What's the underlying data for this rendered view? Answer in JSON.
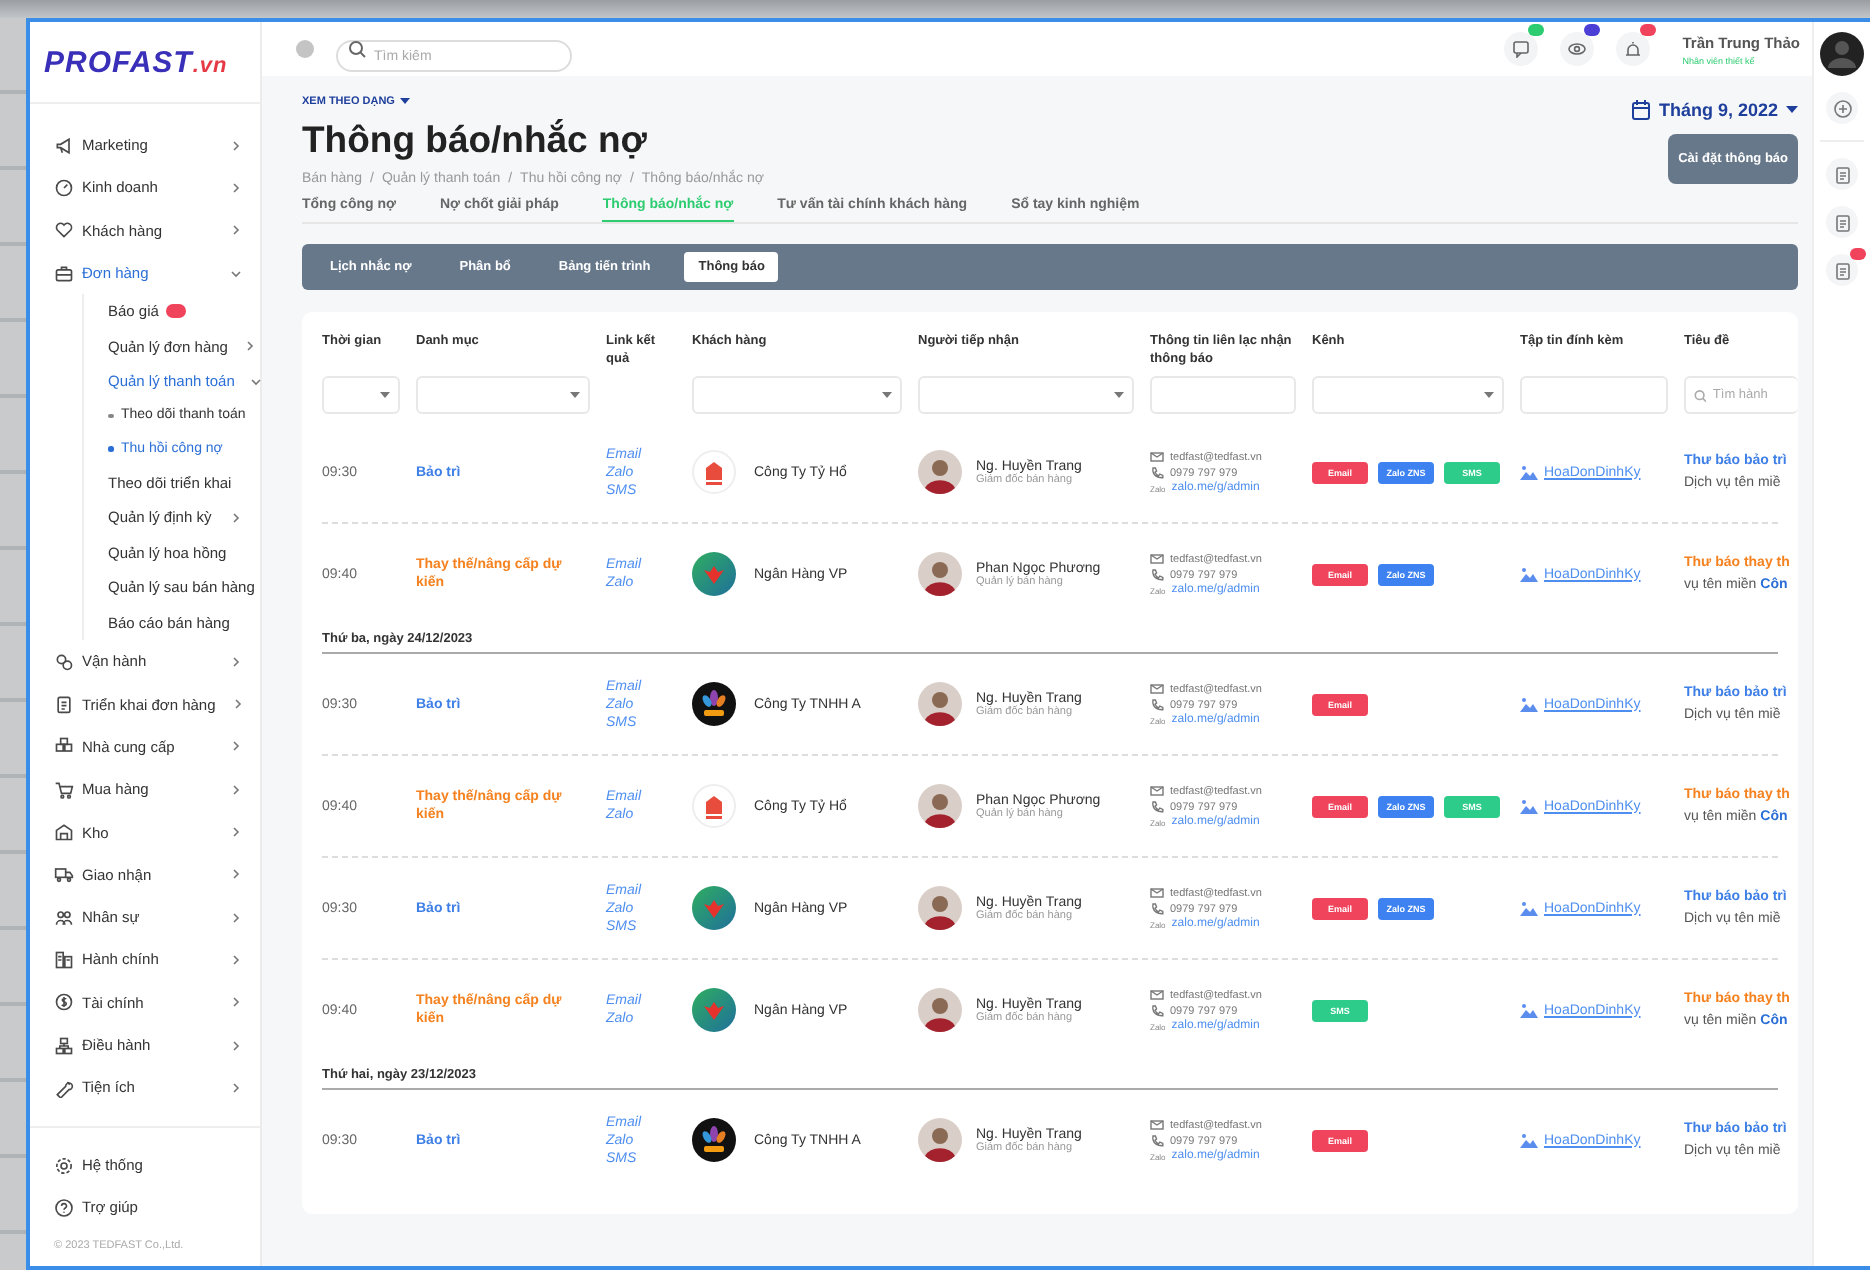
{
  "sidebar": {
    "logo": "PROFAST",
    "logo_suffix": ".vn",
    "nav": [
      {
        "label": "Marketing",
        "kind": "group",
        "expanded": false,
        "selected": false
      },
      {
        "label": "Kinh doanh",
        "kind": "group",
        "expanded": false,
        "selected": false
      },
      {
        "label": "Khách hàng",
        "kind": "group",
        "expanded": false,
        "selected": false
      },
      {
        "label": "Đơn hàng",
        "kind": "group",
        "expanded": true,
        "selected": true,
        "children": [
          {
            "label": "Báo giá",
            "kind": "link",
            "selected": false,
            "badge": true
          },
          {
            "label": "Quản lý đơn hàng",
            "kind": "group",
            "expanded": false,
            "selected": false
          },
          {
            "label": "Quản lý thanh toán",
            "kind": "group",
            "expanded": true,
            "selected": true,
            "children": [
              {
                "label": "Theo dõi thanh toán",
                "kind": "bullet",
                "selected": false
              },
              {
                "label": "Thu hồi công nợ",
                "kind": "bullet",
                "selected": true
              }
            ]
          },
          {
            "label": "Theo dõi triển khai",
            "kind": "link",
            "selected": false
          },
          {
            "label": "Quản lý định kỳ",
            "kind": "group",
            "expanded": false,
            "selected": false
          },
          {
            "label": "Quản lý hoa hồng",
            "kind": "link",
            "selected": false
          },
          {
            "label": "Quản lý sau bán hàng",
            "kind": "link",
            "selected": false
          },
          {
            "label": "Báo cáo bán hàng",
            "kind": "link",
            "selected": false
          }
        ]
      },
      {
        "label": "Vận hành",
        "kind": "group",
        "expanded": false,
        "selected": false
      },
      {
        "label": "Triển khai đơn hàng",
        "kind": "group",
        "expanded": false,
        "selected": false
      },
      {
        "label": "Nhà cung cấp",
        "kind": "group",
        "expanded": false,
        "selected": false
      },
      {
        "label": "Mua hàng",
        "kind": "group",
        "expanded": false,
        "selected": false
      },
      {
        "label": "Kho",
        "kind": "group",
        "expanded": false,
        "selected": false
      },
      {
        "label": "Giao nhận",
        "kind": "group",
        "expanded": false,
        "selected": false
      },
      {
        "label": "Nhân sự",
        "kind": "group",
        "expanded": false,
        "selected": false
      },
      {
        "label": "Hành chính",
        "kind": "group",
        "expanded": false,
        "selected": false
      },
      {
        "label": "Tài chính",
        "kind": "group",
        "expanded": false,
        "selected": false
      },
      {
        "label": "Điều hành",
        "kind": "group",
        "expanded": false,
        "selected": false
      },
      {
        "label": "Tiện ích",
        "kind": "group",
        "expanded": false,
        "selected": false
      }
    ],
    "footer_nav": [
      {
        "label": "Hệ thống"
      },
      {
        "label": "Trợ giúp"
      }
    ],
    "copyright": "© 2023 TEDFAST Co.,Ltd."
  },
  "topbar": {
    "search": {
      "placeholder": "Tìm kiếm"
    },
    "icons": [
      {
        "color": "#2ecc71"
      },
      {
        "color": "#4b3fd6"
      },
      {
        "color": "#f0435c"
      }
    ],
    "user": {
      "name": "Trần Trung Thảo",
      "role": "Nhân viên thiết kế"
    }
  },
  "rail": [
    {
      "badge": false
    },
    {
      "badge": false
    },
    {
      "badge": false
    },
    {
      "badge": true
    }
  ],
  "page": {
    "view_switch": {
      "label": "XEM THEO DẠNG",
      "expanded": false
    },
    "title": "Thông báo/nhắc nợ",
    "breadcrumb": [
      {
        "label": "Bán hàng"
      },
      {
        "separator": "/",
        "label": "Quản lý thanh toán"
      },
      {
        "separator": "/",
        "label": "Thu hồi công nợ"
      },
      {
        "separator": "/",
        "label": "Thông báo/nhắc nợ"
      }
    ],
    "month": "Tháng 9, 2022",
    "settings_button": "Cài đặt thông báo"
  },
  "tabs": [
    {
      "label": "Tổng công nợ",
      "selected": false
    },
    {
      "label": "Nợ chốt giải pháp",
      "selected": false
    },
    {
      "label": "Thông báo/nhắc nợ",
      "selected": true
    },
    {
      "label": "Tư vấn tài chính khách hàng",
      "selected": false
    },
    {
      "label": "Sổ tay kinh nghiệm",
      "selected": false
    }
  ],
  "subtabs": [
    {
      "label": "Lịch nhắc nợ",
      "selected": false
    },
    {
      "label": "Phân bổ",
      "selected": false
    },
    {
      "label": "Bảng tiến trình",
      "selected": false
    },
    {
      "label": "Thông báo",
      "selected": true
    }
  ],
  "table": {
    "columns": [
      {
        "label": "Thời gian",
        "filter": {
          "kind": "select"
        }
      },
      {
        "label": "Danh mục",
        "filter": {
          "kind": "select"
        }
      },
      {
        "label": "Link kết quả"
      },
      {
        "label": "Khách hàng",
        "filter": {
          "kind": "select"
        }
      },
      {
        "label": "Người tiếp nhận",
        "filter": {
          "kind": "select"
        }
      },
      {
        "label": "Thông tin liên lạc nhận thông báo",
        "filter": {
          "kind": "input"
        }
      },
      {
        "label": "Kênh",
        "filter": {
          "kind": "select"
        }
      },
      {
        "label": "Tập tin đính kèm",
        "filter": {
          "kind": "input"
        }
      },
      {
        "label": "Tiêu đề",
        "filter": {
          "kind": "search",
          "placeholder": "Tìm hành"
        }
      }
    ],
    "groups": [
      {
        "rows": [
          {
            "time": "09:30",
            "kind": "maintenance",
            "category": "Bảo trì",
            "links": [
              "Email",
              "Zalo",
              "SMS"
            ],
            "customer": {
              "name": "Công Ty Tỷ Hổ",
              "kind": "tyho"
            },
            "recipient": {
              "name": "Ng. Huyền Trang",
              "role": "Giám đốc bán hàng"
            },
            "contact": {
              "email": "tedfast@tedfast.vn",
              "phone": "0979 797 979",
              "zalo_label": "Zalo",
              "zalo": "zalo.me/g/admin"
            },
            "channels": [
              {
                "label": "Email",
                "color": "#f0435c"
              },
              {
                "label": "Zalo ZNS",
                "color": "#3d82f0"
              },
              {
                "label": "SMS",
                "color": "#2ecc8a"
              }
            ],
            "file": "HoaDonDinhKy",
            "title": "Thư báo bảo trì",
            "subtitle": "Dịch vụ tên miề"
          },
          {
            "time": "09:40",
            "kind": "replace",
            "category": "Thay thế/nâng cấp dự kiến",
            "links": [
              "Email",
              "Zalo"
            ],
            "customer": {
              "name": "Ngân Hàng VP",
              "kind": "bank"
            },
            "recipient": {
              "name": "Phan Ngọc Phương",
              "role": "Quản lý bán hàng"
            },
            "contact": {
              "email": "tedfast@tedfast.vn",
              "phone": "0979 797 979",
              "zalo_label": "Zalo",
              "zalo": "zalo.me/g/admin"
            },
            "channels": [
              {
                "label": "Email",
                "color": "#f0435c"
              },
              {
                "label": "Zalo ZNS",
                "color": "#3d82f0"
              }
            ],
            "file": "HoaDonDinhKy",
            "title": "Thư báo thay th",
            "subtitle": "vụ tên miền **Côn**"
          }
        ]
      },
      {
        "date": "Thứ ba, ngày 24/12/2023",
        "rows": [
          {
            "time": "09:30",
            "kind": "maintenance",
            "category": "Bảo trì",
            "links": [
              "Email",
              "Zalo",
              "SMS"
            ],
            "customer": {
              "name": "Công Ty TNHH A",
              "kind": "lotus"
            },
            "recipient": {
              "name": "Ng. Huyền Trang",
              "role": "Giám đốc bán hàng"
            },
            "contact": {
              "email": "tedfast@tedfast.vn",
              "phone": "0979 797 979",
              "zalo_label": "Zalo",
              "zalo": "zalo.me/g/admin"
            },
            "channels": [
              {
                "label": "Email",
                "color": "#f0435c"
              }
            ],
            "file": "HoaDonDinhKy",
            "title": "Thư báo bảo trì",
            "subtitle": "Dịch vụ tên miề"
          },
          {
            "time": "09:40",
            "kind": "replace",
            "category": "Thay thế/nâng cấp dự kiến",
            "links": [
              "Email",
              "Zalo"
            ],
            "customer": {
              "name": "Công Ty Tỷ Hổ",
              "kind": "tyho"
            },
            "recipient": {
              "name": "Phan Ngọc Phương",
              "role": "Quản lý bán hàng"
            },
            "contact": {
              "email": "tedfast@tedfast.vn",
              "phone": "0979 797 979",
              "zalo_label": "Zalo",
              "zalo": "zalo.me/g/admin"
            },
            "channels": [
              {
                "label": "Email",
                "color": "#f0435c"
              },
              {
                "label": "Zalo ZNS",
                "color": "#3d82f0"
              },
              {
                "label": "SMS",
                "color": "#2ecc8a"
              }
            ],
            "file": "HoaDonDinhKy",
            "title": "Thư báo thay th",
            "subtitle": "vụ tên miền **Côn**"
          },
          {
            "time": "09:30",
            "kind": "maintenance",
            "category": "Bảo trì",
            "links": [
              "Email",
              "Zalo",
              "SMS"
            ],
            "customer": {
              "name": "Ngân Hàng VP",
              "kind": "bank"
            },
            "recipient": {
              "name": "Ng. Huyền Trang",
              "role": "Giám đốc bán hàng"
            },
            "contact": {
              "email": "tedfast@tedfast.vn",
              "phone": "0979 797 979",
              "zalo_label": "Zalo",
              "zalo": "zalo.me/g/admin"
            },
            "channels": [
              {
                "label": "Email",
                "color": "#f0435c"
              },
              {
                "label": "Zalo ZNS",
                "color": "#3d82f0"
              }
            ],
            "file": "HoaDonDinhKy",
            "title": "Thư báo bảo trì",
            "subtitle": "Dịch vụ tên miề"
          },
          {
            "time": "09:40",
            "kind": "replace",
            "category": "Thay thế/nâng cấp dự kiến",
            "links": [
              "Email",
              "Zalo"
            ],
            "customer": {
              "name": "Ngân Hàng VP",
              "kind": "bank"
            },
            "recipient": {
              "name": "Ng. Huyền Trang",
              "role": "Giám đốc bán hàng"
            },
            "contact": {
              "email": "tedfast@tedfast.vn",
              "phone": "0979 797 979",
              "zalo_label": "Zalo",
              "zalo": "zalo.me/g/admin"
            },
            "channels": [
              {
                "label": "SMS",
                "color": "#2ecc8a"
              }
            ],
            "file": "HoaDonDinhKy",
            "title": "Thư báo thay th",
            "subtitle": "vụ tên miền **Côn**"
          }
        ]
      },
      {
        "date": "Thứ hai, ngày 23/12/2023",
        "rows": [
          {
            "time": "09:30",
            "kind": "maintenance",
            "category": "Bảo trì",
            "links": [
              "Email",
              "Zalo",
              "SMS"
            ],
            "customer": {
              "name": "Công Ty TNHH A",
              "kind": "lotus"
            },
            "recipient": {
              "name": "Ng. Huyền Trang",
              "role": "Giám đốc bán hàng"
            },
            "contact": {
              "email": "tedfast@tedfast.vn",
              "phone": "0979 797 979",
              "zalo_label": "Zalo",
              "zalo": "zalo.me/g/admin"
            },
            "channels": [
              {
                "label": "Email",
                "color": "#f0435c"
              }
            ],
            "file": "HoaDonDinhKy",
            "title": "Thư báo bảo trì",
            "subtitle": "Dịch vụ tên miề"
          }
        ]
      }
    ]
  }
}
